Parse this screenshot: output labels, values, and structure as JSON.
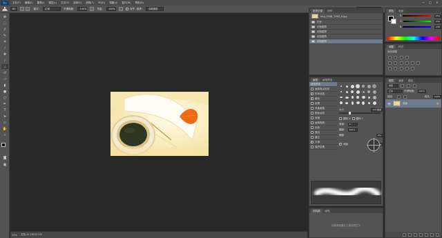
{
  "app": {
    "logo": "Ps"
  },
  "menubar": {
    "items": [
      "文件(F)",
      "编辑(E)",
      "图像(I)",
      "图层(L)",
      "文字(Y)",
      "选择(S)",
      "滤镜(T)",
      "3D(D)",
      "视图(V)",
      "窗口(W)",
      "帮助(H)"
    ],
    "minimize": "—",
    "maximize": "□",
    "close": "✕"
  },
  "options": {
    "brush_size": "60",
    "mode_label": "模式：",
    "mode_value": "正常",
    "opacity_label": "不透明度：",
    "opacity_value": "100%",
    "flow_label": "流量：",
    "flow_value": "100%",
    "sample_label": "取样：",
    "sample_value": "当前图层",
    "align_label": "对齐",
    "workspace": "基本功能"
  },
  "tools": [
    "move",
    "marquee",
    "lasso",
    "quick-select",
    "crop",
    "eyedropper",
    "healing",
    "brush",
    "clone",
    "history-brush",
    "eraser",
    "gradient",
    "blur",
    "dodge",
    "pen",
    "type",
    "path-select",
    "shape",
    "hand",
    "zoom"
  ],
  "status": {
    "zoom": "25%",
    "doc": "文档:10.1M/10.1M"
  },
  "history": {
    "tabs": [
      "历史记录",
      "动作"
    ],
    "snapshot": "img_2048_1365_6.jpg",
    "items": [
      "打开",
      "仿制图章",
      "仿制图章",
      "仿制图章",
      "仿制图章"
    ]
  },
  "color": {
    "tabs": [
      "颜色",
      "色板"
    ],
    "r_label": "R",
    "r_value": "254",
    "g_label": "G",
    "g_value": "250",
    "b_label": "B",
    "b_value": "248"
  },
  "adjust": {
    "tabs": [
      "调整",
      "样式"
    ],
    "hint": "添加调整"
  },
  "layers": {
    "tabs": [
      "图层",
      "通道",
      "路径"
    ],
    "kind": "类型",
    "blend": "正常",
    "opacity_label": "不透明度：",
    "opacity": "100%",
    "lock_label": "锁定：",
    "fill_label": "填充：",
    "fill": "100%",
    "layer_name": "背景"
  },
  "brush_panel": {
    "tabs": [
      "画笔",
      "画笔预设"
    ],
    "preset_button": "画笔预设",
    "items": [
      {
        "label": "画笔笔尖形状",
        "on": false,
        "sel": true
      },
      {
        "label": "形状动态",
        "on": true
      },
      {
        "label": "散布",
        "on": true
      },
      {
        "label": "纹理",
        "on": false
      },
      {
        "label": "双重画笔",
        "on": false
      },
      {
        "label": "颜色动态",
        "on": false
      },
      {
        "label": "传递",
        "on": false
      },
      {
        "label": "画笔笔势",
        "on": false
      },
      {
        "label": "杂色",
        "on": false
      },
      {
        "label": "湿边",
        "on": false
      },
      {
        "label": "建立",
        "on": false
      },
      {
        "label": "平滑",
        "on": true
      },
      {
        "label": "保护纹理",
        "on": false
      }
    ],
    "size_label": "大小",
    "size_value": "100 像素",
    "flipx": "翻转 X",
    "flipy": "翻转 Y",
    "angle_label": "角度：",
    "angle_value": "0°",
    "round_label": "圆度：",
    "round_value": "100%",
    "hardness_label": "硬度",
    "hardness_value": "0%",
    "spacing_label": "间距",
    "spacing_value": "25%"
  },
  "clone_source": {
    "tabs": [
      "仿制源",
      "画笔"
    ],
    "hint": "仿制源设置在工具选项栏中"
  },
  "colors_hex": {
    "bg": "#282828",
    "panel": "#535353",
    "selected": "#6d7a8c",
    "logo": "#2fa3ff"
  }
}
